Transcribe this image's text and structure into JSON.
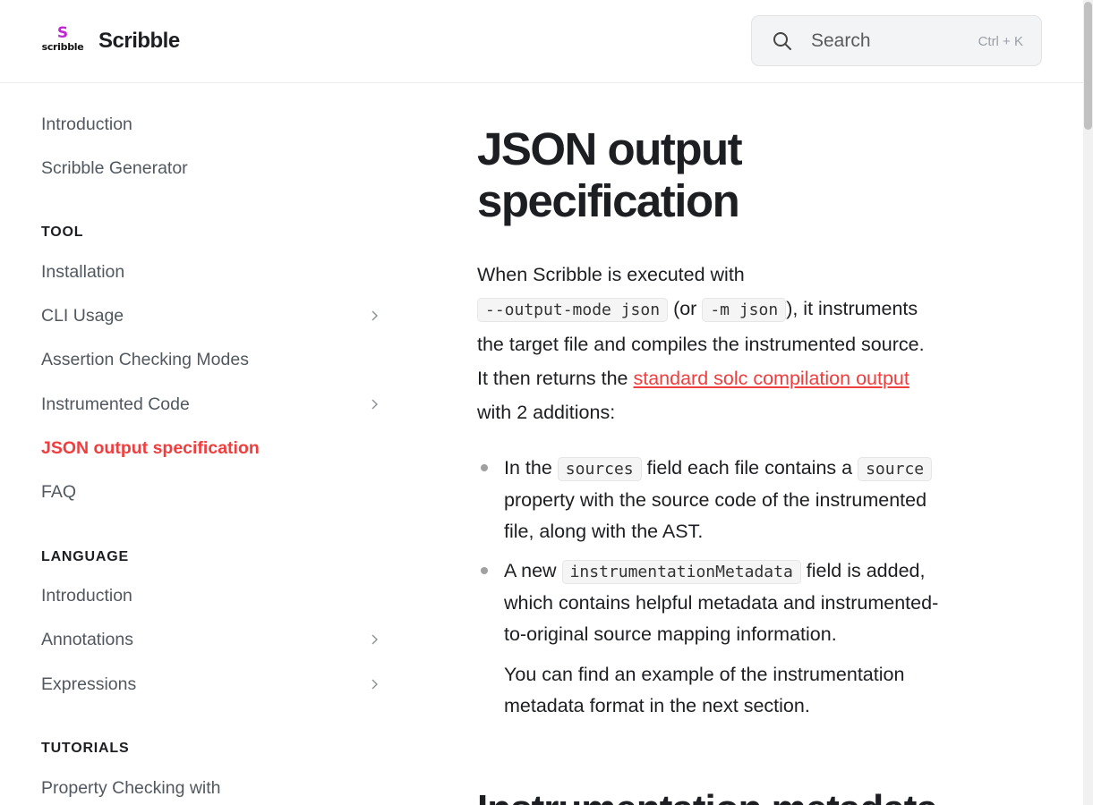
{
  "header": {
    "logo_symbol": "S",
    "logo_word": "scribble",
    "brand": "Scribble",
    "search_placeholder": "Search",
    "search_shortcut": "Ctrl + K"
  },
  "sidebar": {
    "top_items": [
      {
        "label": "Introduction"
      },
      {
        "label": "Scribble Generator"
      }
    ],
    "sections": [
      {
        "title": "TOOL",
        "items": [
          {
            "label": "Installation",
            "expandable": false
          },
          {
            "label": "CLI Usage",
            "expandable": true
          },
          {
            "label": "Assertion Checking Modes",
            "expandable": false
          },
          {
            "label": "Instrumented Code",
            "expandable": true
          },
          {
            "label": "JSON output specification",
            "expandable": false,
            "active": true
          },
          {
            "label": "FAQ",
            "expandable": false
          }
        ]
      },
      {
        "title": "LANGUAGE",
        "items": [
          {
            "label": "Introduction",
            "expandable": false
          },
          {
            "label": "Annotations",
            "expandable": true
          },
          {
            "label": "Expressions",
            "expandable": true
          }
        ]
      },
      {
        "title": "TUTORIALS",
        "items": [
          {
            "label": "Property Checking with",
            "expandable": false
          }
        ]
      }
    ]
  },
  "main": {
    "title_line1": "JSON output",
    "title_line2": "specification",
    "intro": {
      "t1": "When Scribble is executed with",
      "code1": "--output-mode json",
      "t2": "(or",
      "code2": "-m json",
      "t3": "), it instruments",
      "t4": "the target file and compiles the instrumented source.",
      "t5": "It then returns the",
      "link": "standard solc compilation output",
      "t6": "with 2 additions:"
    },
    "bullets": {
      "b1_t1": "In the",
      "b1_code1": "sources",
      "b1_t2": "field each file contains a",
      "b1_code2": "source",
      "b1_t3": "property with the source code of the instrumented",
      "b1_t4": "file, along with the AST.",
      "b2_t1": "A new",
      "b2_code1": "instrumentationMetadata",
      "b2_t2": "field is added,",
      "b2_t3": "which contains helpful metadata and instrumented-",
      "b2_t4": "to-original source mapping information.",
      "b2_p2_l1": "You can find an example of the instrumentation",
      "b2_p2_l2": "metadata format in the next section."
    },
    "next_heading": "Instrumentation metadata"
  }
}
